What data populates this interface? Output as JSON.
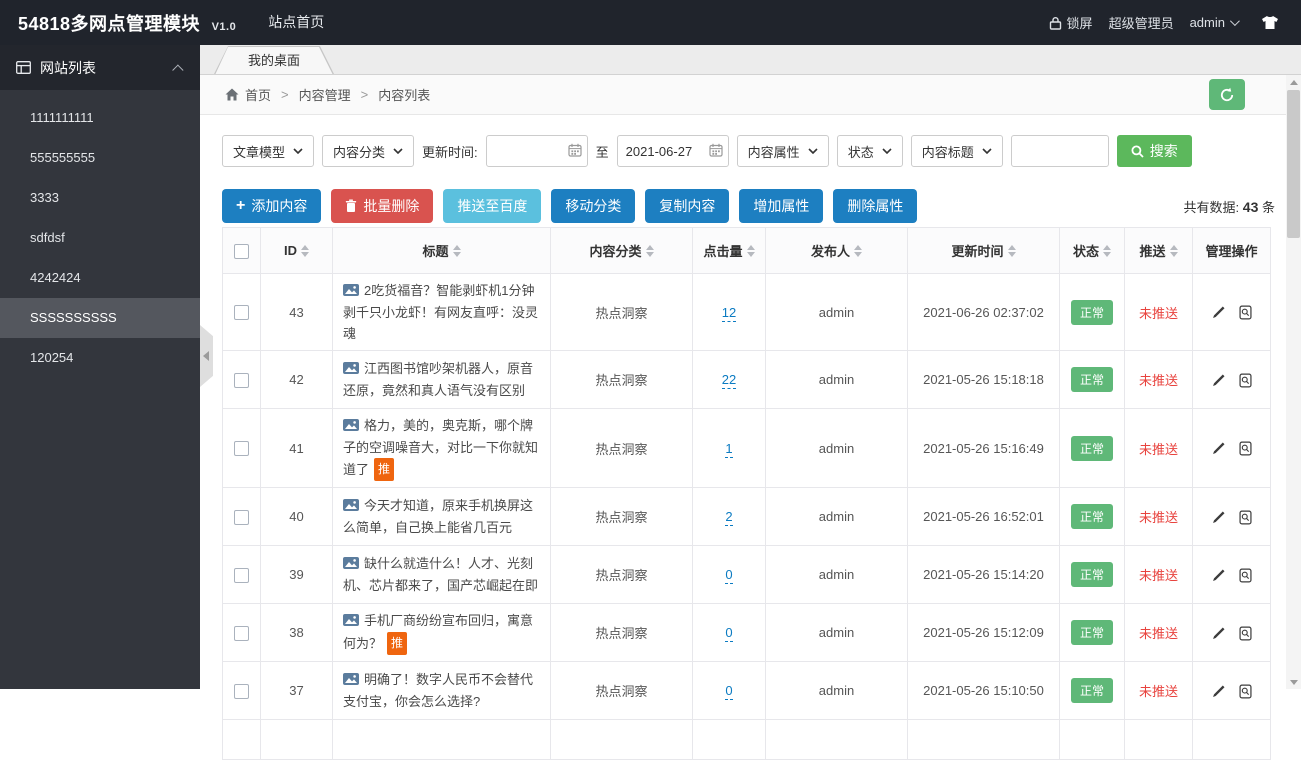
{
  "navbar": {
    "brand": "54818多网点管理模块",
    "version": "V1.0",
    "menu_site_home": "站点首页",
    "lock_label": "锁屏",
    "role_label": "超级管理员",
    "username": "admin"
  },
  "sidebar": {
    "title": "网站列表",
    "items": [
      {
        "label": "1111111111",
        "active": false
      },
      {
        "label": "555555555",
        "active": false
      },
      {
        "label": "3333",
        "active": false
      },
      {
        "label": "sdfdsf",
        "active": false
      },
      {
        "label": "4242424",
        "active": false
      },
      {
        "label": "SSSSSSSSSS",
        "active": true
      },
      {
        "label": "120254",
        "active": false
      }
    ]
  },
  "tabs": {
    "active": "我的桌面"
  },
  "breadcrumb": {
    "home": "首页",
    "mid": "内容管理",
    "last": "内容列表"
  },
  "filters": {
    "model": "文章模型",
    "category": "内容分类",
    "update_time_label": "更新时间:",
    "date_from": "",
    "to_label": "至",
    "date_to": "2021-06-27",
    "attribute": "内容属性",
    "status": "状态",
    "title_field": "内容标题",
    "keyword": "",
    "search": "搜索"
  },
  "toolbar": {
    "add": "添加内容",
    "batch_delete": "批量删除",
    "push_baidu": "推送至百度",
    "move_category": "移动分类",
    "copy_content": "复制内容",
    "add_attr": "增加属性",
    "delete_attr": "删除属性",
    "total_prefix": "共有数据:",
    "total_count": "43",
    "total_suffix": "条"
  },
  "table": {
    "push_badge": "推",
    "columns": [
      {
        "label": "ID",
        "sortable": true
      },
      {
        "label": "标题",
        "sortable": true
      },
      {
        "label": "内容分类",
        "sortable": true
      },
      {
        "label": "点击量",
        "sortable": true
      },
      {
        "label": "发布人",
        "sortable": true
      },
      {
        "label": "更新时间",
        "sortable": true
      },
      {
        "label": "状态",
        "sortable": true
      },
      {
        "label": "推送",
        "sortable": true
      },
      {
        "label": "管理操作",
        "sortable": false
      }
    ],
    "rows": [
      {
        "id": "43",
        "title": "2吃货福音？智能剥虾机1分钟剥千只小龙虾！有网友直呼：没灵魂",
        "push_flag": false,
        "category": "热点洞察",
        "clicks": "12",
        "publisher": "admin",
        "updated": "2021-06-26 02:37:02",
        "status": "正常",
        "push": "未推送"
      },
      {
        "id": "42",
        "title": "江西图书馆吵架机器人，原音还原，竟然和真人语气没有区别",
        "push_flag": false,
        "category": "热点洞察",
        "clicks": "22",
        "publisher": "admin",
        "updated": "2021-05-26 15:18:18",
        "status": "正常",
        "push": "未推送"
      },
      {
        "id": "41",
        "title": "格力，美的，奥克斯，哪个牌子的空调噪音大，对比一下你就知道了",
        "push_flag": true,
        "category": "热点洞察",
        "clicks": "1",
        "publisher": "admin",
        "updated": "2021-05-26 15:16:49",
        "status": "正常",
        "push": "未推送"
      },
      {
        "id": "40",
        "title": "今天才知道，原来手机换屏这么简单，自己换上能省几百元",
        "push_flag": false,
        "category": "热点洞察",
        "clicks": "2",
        "publisher": "admin",
        "updated": "2021-05-26 16:52:01",
        "status": "正常",
        "push": "未推送"
      },
      {
        "id": "39",
        "title": "缺什么就造什么！人才、光刻机、芯片都来了，国产芯崛起在即",
        "push_flag": false,
        "category": "热点洞察",
        "clicks": "0",
        "publisher": "admin",
        "updated": "2021-05-26 15:14:20",
        "status": "正常",
        "push": "未推送"
      },
      {
        "id": "38",
        "title": "手机厂商纷纷宣布回归，寓意何为？",
        "push_flag": true,
        "category": "热点洞察",
        "clicks": "0",
        "publisher": "admin",
        "updated": "2021-05-26 15:12:09",
        "status": "正常",
        "push": "未推送"
      },
      {
        "id": "37",
        "title": "明确了！数字人民币不会替代支付宝，你会怎么选择?",
        "push_flag": false,
        "category": "热点洞察",
        "clicks": "0",
        "publisher": "admin",
        "updated": "2021-05-26 15:10:50",
        "status": "正常",
        "push": "未推送"
      }
    ]
  },
  "colors": {
    "navbar_bg": "#20242c",
    "sidebar_bg": "#33363d",
    "primary_blue": "#1d7fc1",
    "danger_red": "#d9534f",
    "info_blue": "#5bc0de",
    "green": "#5FB878",
    "status_red_text": "#e8433e",
    "push_badge_orange": "#ef650f"
  }
}
